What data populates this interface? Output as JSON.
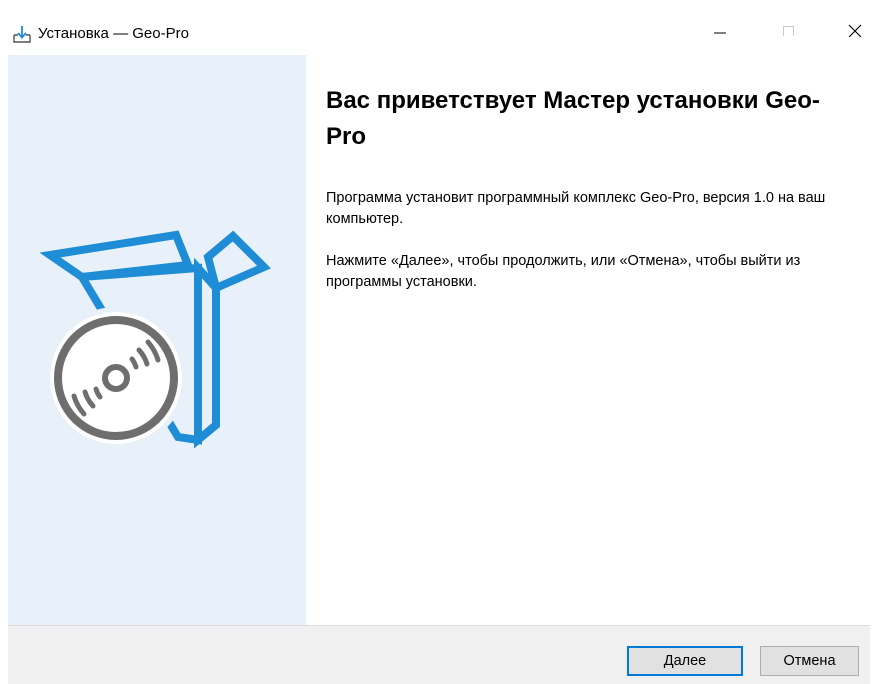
{
  "window": {
    "title": "Установка — Geo-Pro",
    "icon": "installer-download-icon",
    "controls": {
      "minimize": "minimize-icon",
      "maximize": "maximize-icon",
      "close": "close-icon"
    }
  },
  "sidebar": {
    "illustration": "software-box-disc-icon",
    "colors": {
      "background": "#e8f1f9",
      "box": "#1f8dd6",
      "disc": "#6e6e6e"
    }
  },
  "content": {
    "heading": "Вас приветствует Мастер установки Geo-Pro",
    "paragraph_1": "Программа установит программный комплекс Geo-Pro, версия 1.0 на ваш компьютер.",
    "paragraph_2": "Нажмите «Далее», чтобы продолжить, или «Отмена», чтобы выйти из программы установки."
  },
  "footer": {
    "next_label": "Далее",
    "cancel_label": "Отмена",
    "focus_color": "#0078d7"
  }
}
